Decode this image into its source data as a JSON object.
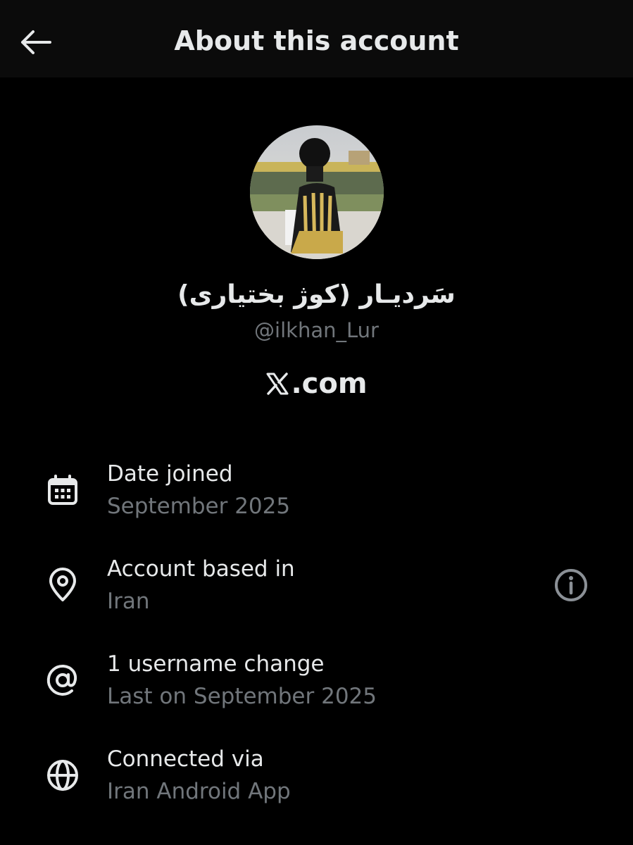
{
  "header": {
    "title": "About this account",
    "back_icon": "arrow-left-icon"
  },
  "profile": {
    "display_name": "سَردیـار (کوژ بختیاری)",
    "handle": "@ilkhan_Lur",
    "domain": ".com",
    "domain_logo": "x-logo-icon"
  },
  "details": [
    {
      "icon": "calendar-icon",
      "label": "Date joined",
      "value": "September 2025"
    },
    {
      "icon": "location-pin-icon",
      "label": "Account based in",
      "value": "Iran",
      "action_icon": "info-icon"
    },
    {
      "icon": "at-sign-icon",
      "label": "1 username change",
      "value": "Last on September 2025"
    },
    {
      "icon": "globe-icon",
      "label": "Connected via",
      "value": "Iran Android App"
    }
  ],
  "colors": {
    "background": "#000000",
    "header_background": "#0b0b0b",
    "primary_text": "#e7e9ea",
    "secondary_text": "#71767b"
  }
}
